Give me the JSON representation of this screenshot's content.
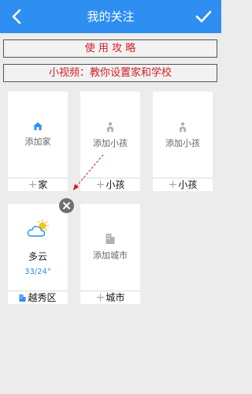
{
  "header": {
    "title": "我的关注",
    "back_icon": "chevron-left-icon",
    "confirm_icon": "check-icon"
  },
  "buttons": {
    "guide_label": "使 用 攻 略",
    "video_label": "小视频：教你设置家和学校"
  },
  "cards": [
    {
      "type": "home",
      "icon": "home-icon",
      "add_label": "添加家",
      "footer_label": "家"
    },
    {
      "type": "child",
      "icon": "child-icon",
      "add_label": "添加小孩",
      "footer_label": "小孩"
    },
    {
      "type": "child",
      "icon": "child-icon",
      "add_label": "添加小孩",
      "footer_label": "小孩"
    }
  ],
  "weather_card": {
    "icon": "partly-cloudy-icon",
    "condition": "多云",
    "temperature": "33/24°",
    "location": "越秀区",
    "location_icon": "building-icon",
    "remove_icon": "close-icon"
  },
  "city_card": {
    "icon": "building-icon",
    "add_label": "添加城市",
    "footer_label": "城市"
  },
  "colors": {
    "header_bg": "#2f8ef1",
    "accent_text": "#d01f26",
    "blue_text": "#2f8ef1",
    "arrow": "#d01f26"
  }
}
